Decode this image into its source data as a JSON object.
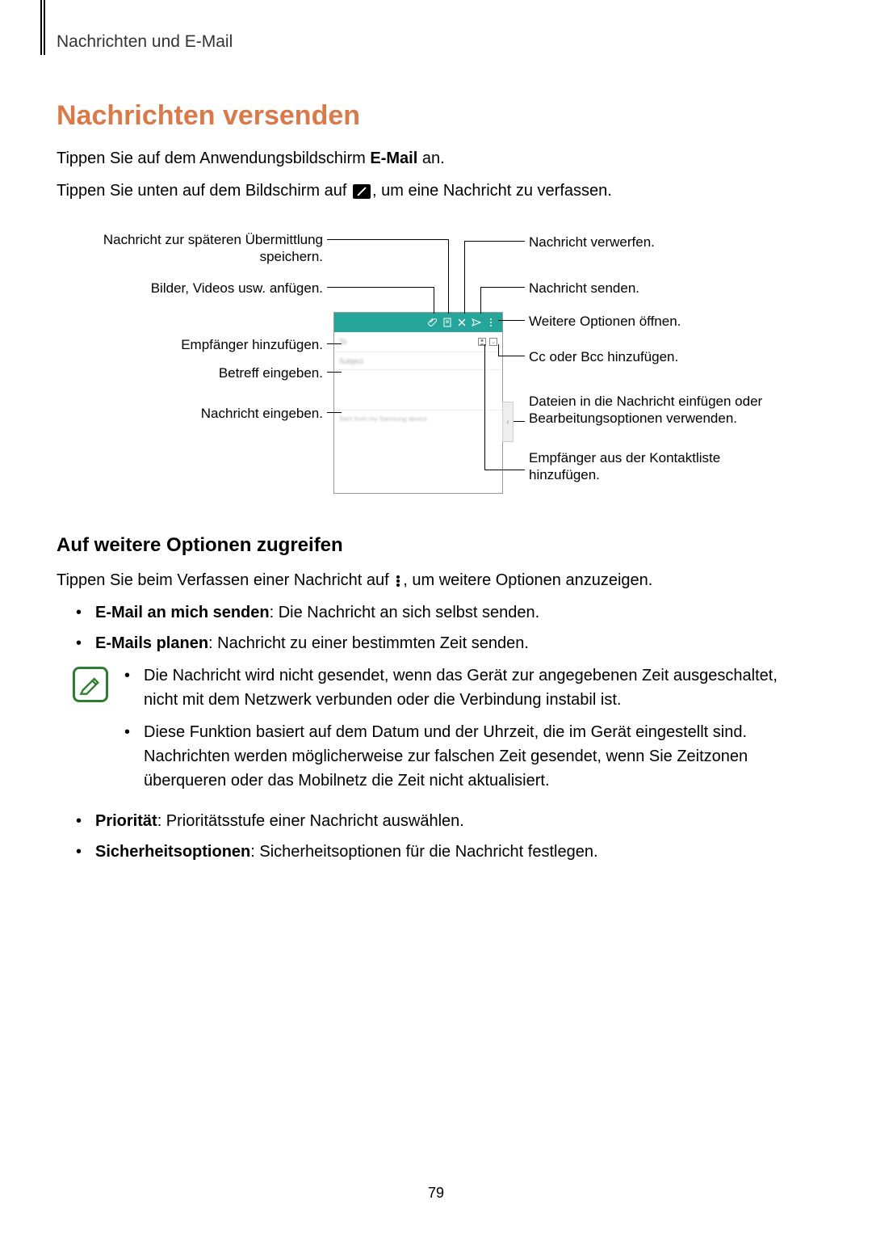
{
  "header": {
    "section": "Nachrichten und E-Mail"
  },
  "h1": "Nachrichten versenden",
  "intro": {
    "p1_a": "Tippen Sie auf dem Anwendungsbildschirm ",
    "p1_b": "E-Mail",
    "p1_c": " an.",
    "p2_a": "Tippen Sie unten auf dem Bildschirm auf ",
    "p2_b": ", um eine Nachricht zu verfassen."
  },
  "diagram": {
    "left": {
      "save": "Nachricht zur späteren Übermittlung speichern.",
      "attach": "Bilder, Videos usw. anfügen.",
      "to": "Empfänger hinzufügen.",
      "subject": "Betreff eingeben.",
      "body": "Nachricht eingeben."
    },
    "right": {
      "discard": "Nachricht verwerfen.",
      "send": "Nachricht senden.",
      "more": "Weitere Optionen öffnen.",
      "cc": "Cc oder Bcc hinzufügen.",
      "insert": "Dateien in die Nachricht einfügen oder Bearbeitungsoptionen verwenden.",
      "contacts": "Empfänger aus der Kontaktliste hinzufügen."
    },
    "screen": {
      "to": "To",
      "subject": "Subject",
      "sig": "Sent from my Samsung device"
    }
  },
  "h2": "Auf weitere Optionen zugreifen",
  "access": {
    "a": "Tippen Sie beim Verfassen einer Nachricht auf ",
    "b": ", um weitere Optionen anzuzeigen."
  },
  "list": {
    "i1_b": "E-Mail an mich senden",
    "i1_t": ": Die Nachricht an sich selbst senden.",
    "i2_b": "E-Mails planen",
    "i2_t": ": Nachricht zu einer bestimmten Zeit senden.",
    "note1": "Die Nachricht wird nicht gesendet, wenn das Gerät zur angegebenen Zeit ausgeschaltet, nicht mit dem Netzwerk verbunden oder die Verbindung instabil ist.",
    "note2": "Diese Funktion basiert auf dem Datum und der Uhrzeit, die im Gerät eingestellt sind. Nachrichten werden möglicherweise zur falschen Zeit gesendet, wenn Sie Zeitzonen überqueren oder das Mobilnetz die Zeit nicht aktualisiert.",
    "i3_b": "Priorität",
    "i3_t": ": Prioritätsstufe einer Nachricht auswählen.",
    "i4_b": "Sicherheitsoptionen",
    "i4_t": ": Sicherheitsoptionen für die Nachricht festlegen."
  },
  "page": "79"
}
